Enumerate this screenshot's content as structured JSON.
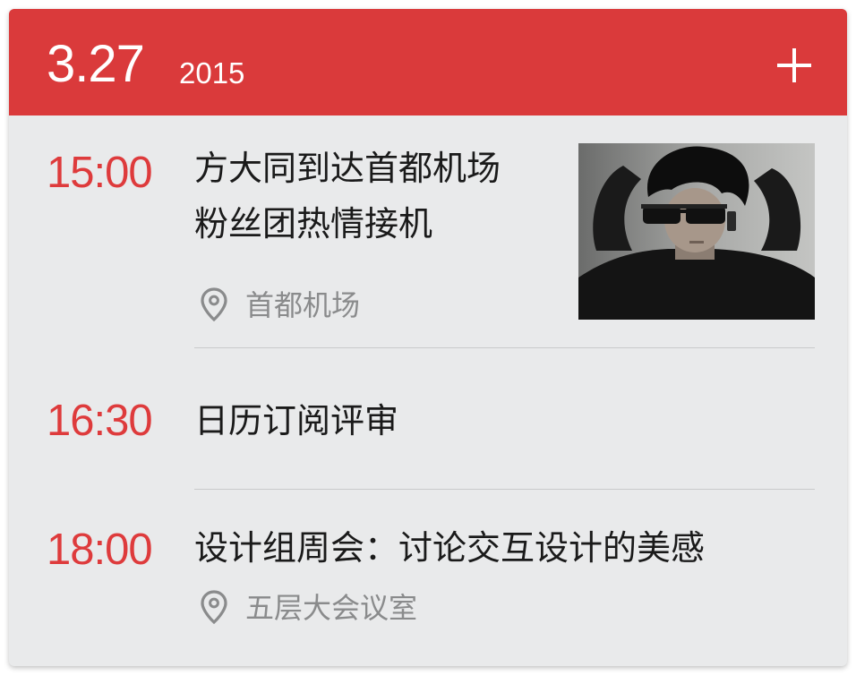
{
  "header": {
    "date": "3.27",
    "year": "2015",
    "add_icon": "plus-icon",
    "color": "#da3a3b"
  },
  "events": [
    {
      "time": "15:00",
      "title_line1": "方大同到达首都机场",
      "title_line2": "粉丝团热情接机",
      "location": "首都机场",
      "location_icon": "map-pin-icon",
      "has_photo": true
    },
    {
      "time": "16:30",
      "title_line1": "日历订阅评审"
    },
    {
      "time": "18:00",
      "title_line1": "设计组周会：讨论交互设计的美感",
      "location": "五层大会议室",
      "location_icon": "map-pin-icon"
    }
  ],
  "colors": {
    "accent": "#da3a3b",
    "time": "#de3b3c",
    "background": "#e9eaeb",
    "secondary_text": "#8a8b8c"
  }
}
